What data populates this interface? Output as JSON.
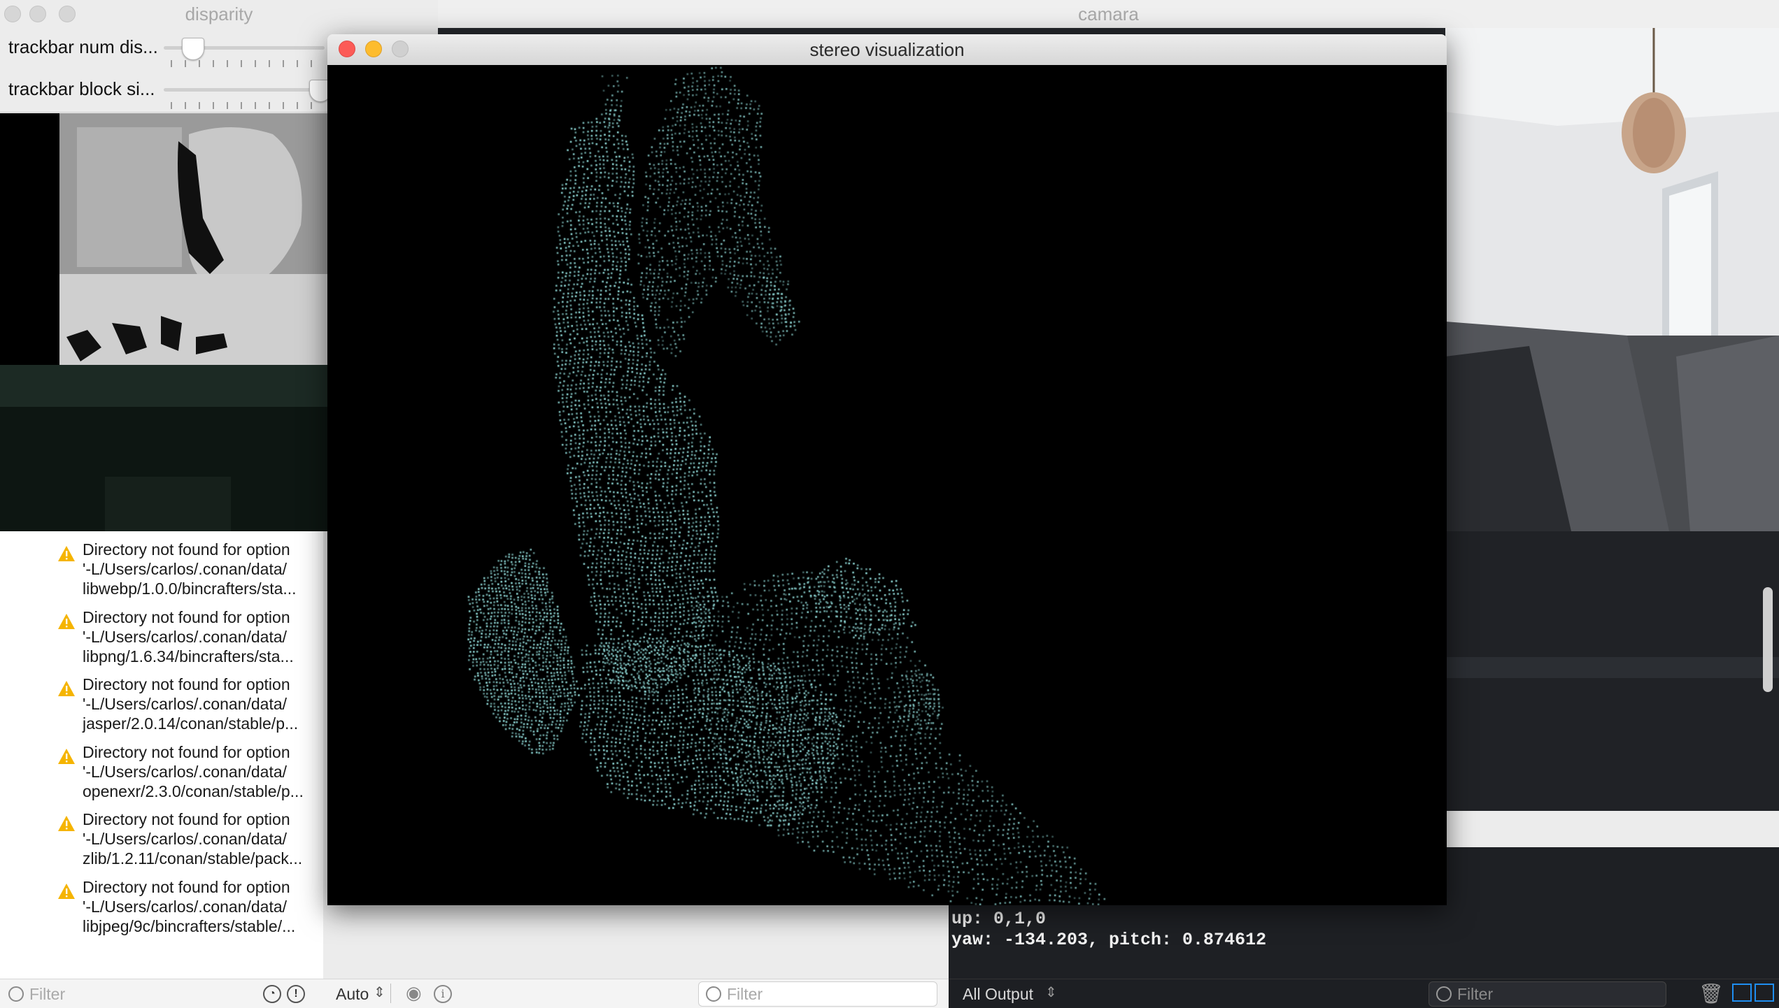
{
  "windows": {
    "camara": {
      "title": "camara"
    },
    "disparity": {
      "title": "disparity",
      "trackbars": [
        {
          "label": "trackbar num dis...",
          "value_fraction": 0.18
        },
        {
          "label": "trackbar block si...",
          "value_fraction": 0.97
        }
      ]
    },
    "stereo": {
      "title": "stereo visualization",
      "point_color": "#8fd8d6"
    }
  },
  "issues": [
    {
      "line1": "Directory not found for option",
      "line2": "'-L/Users/carlos/.conan/data/",
      "line3": "libwebp/1.0.0/bincrafters/sta..."
    },
    {
      "line1": "Directory not found for option",
      "line2": "'-L/Users/carlos/.conan/data/",
      "line3": "libpng/1.6.34/bincrafters/sta..."
    },
    {
      "line1": "Directory not found for option",
      "line2": "'-L/Users/carlos/.conan/data/",
      "line3": "jasper/2.0.14/conan/stable/p..."
    },
    {
      "line1": "Directory not found for option",
      "line2": "'-L/Users/carlos/.conan/data/",
      "line3": "openexr/2.3.0/conan/stable/p..."
    },
    {
      "line1": "Directory not found for option",
      "line2": "'-L/Users/carlos/.conan/data/",
      "line3": "zlib/1.2.11/conan/stable/pack..."
    },
    {
      "line1": "Directory not found for option",
      "line2": "'-L/Users/carlos/.conan/data/",
      "line3": "libjpeg/9c/bincrafters/stable/..."
    }
  ],
  "bottom_bars": {
    "issues_filter_placeholder": "Filter",
    "variables_scope": "Auto",
    "variables_filter_placeholder": "Filter",
    "console_scope": "All Output",
    "console_filter_placeholder": "Filter"
  },
  "console": {
    "lines": [
      "up: 0,1,0",
      "yaw: -134.203, pitch: 0.874612"
    ]
  },
  "colors": {
    "warning": "#f5b400",
    "close": "#fc5b57",
    "minimize": "#fdbc2e",
    "zoom_inactive": "#d0d0d0",
    "console_bg": "#1e2024",
    "accent_blue": "#1f8ef1"
  }
}
